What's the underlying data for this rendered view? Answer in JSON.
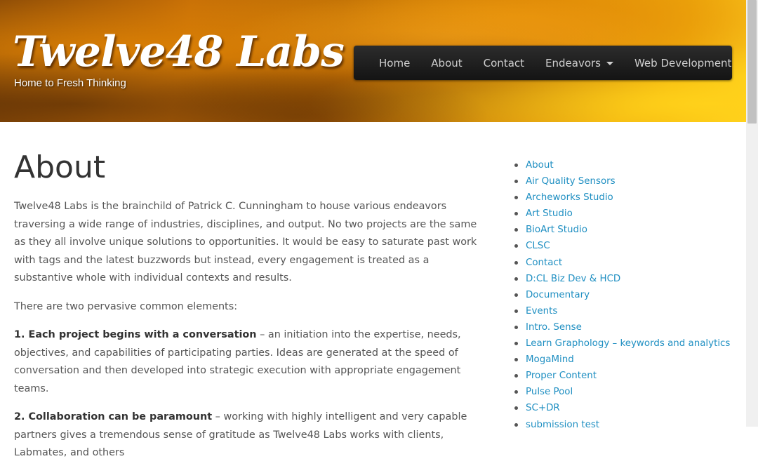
{
  "header": {
    "logo_title": "Twelve48 Labs",
    "tagline": "Home to Fresh Thinking"
  },
  "nav": {
    "items": [
      {
        "label": "Home"
      },
      {
        "label": "About"
      },
      {
        "label": "Contact"
      },
      {
        "label": "Endeavors",
        "has_dropdown": true
      },
      {
        "label": "Web Development"
      }
    ]
  },
  "main": {
    "title": "About",
    "intro": "Twelve48 Labs is the brainchild of Patrick C. Cunningham to house various endeavors traversing a wide range of industries, disciplines, and output. No two projects are the same as they all involve unique solutions to opportunities. It would be easy to saturate past work with tags and the latest buzzwords but instead, every engagement is treated as a substantive whole with individual contexts and results.",
    "common_elements": "There are two pervasive common elements:",
    "point1_heading": "1. Each project begins with a conversation",
    "point1_text": " – an initiation into the expertise, needs, objectives, and capabilities of participating parties. Ideas are generated at the speed of conversation and then developed into strategic execution with appropriate engagement teams.",
    "point2_heading": "2. Collaboration can be paramount",
    "point2_text": " – working with highly intelligent and very capable partners gives a tremendous sense of gratitude as Twelve48 Labs works with clients, Labmates, and others"
  },
  "sidebar": {
    "links": [
      "About",
      "Air Quality Sensors",
      "Archeworks Studio",
      "Art Studio",
      "BioArt Studio",
      "CLSC",
      "Contact",
      "D:CL Biz Dev & HCD",
      "Documentary",
      "Events",
      "Intro. Sense",
      "Learn Graphology – keywords and analytics",
      "MogaMind",
      "Proper Content",
      "Pulse Pool",
      "SC+DR",
      "submission test"
    ]
  },
  "colors": {
    "link": "#1f8fc2",
    "navbar": "#1c1c1c",
    "header_orange": "#d88708"
  }
}
